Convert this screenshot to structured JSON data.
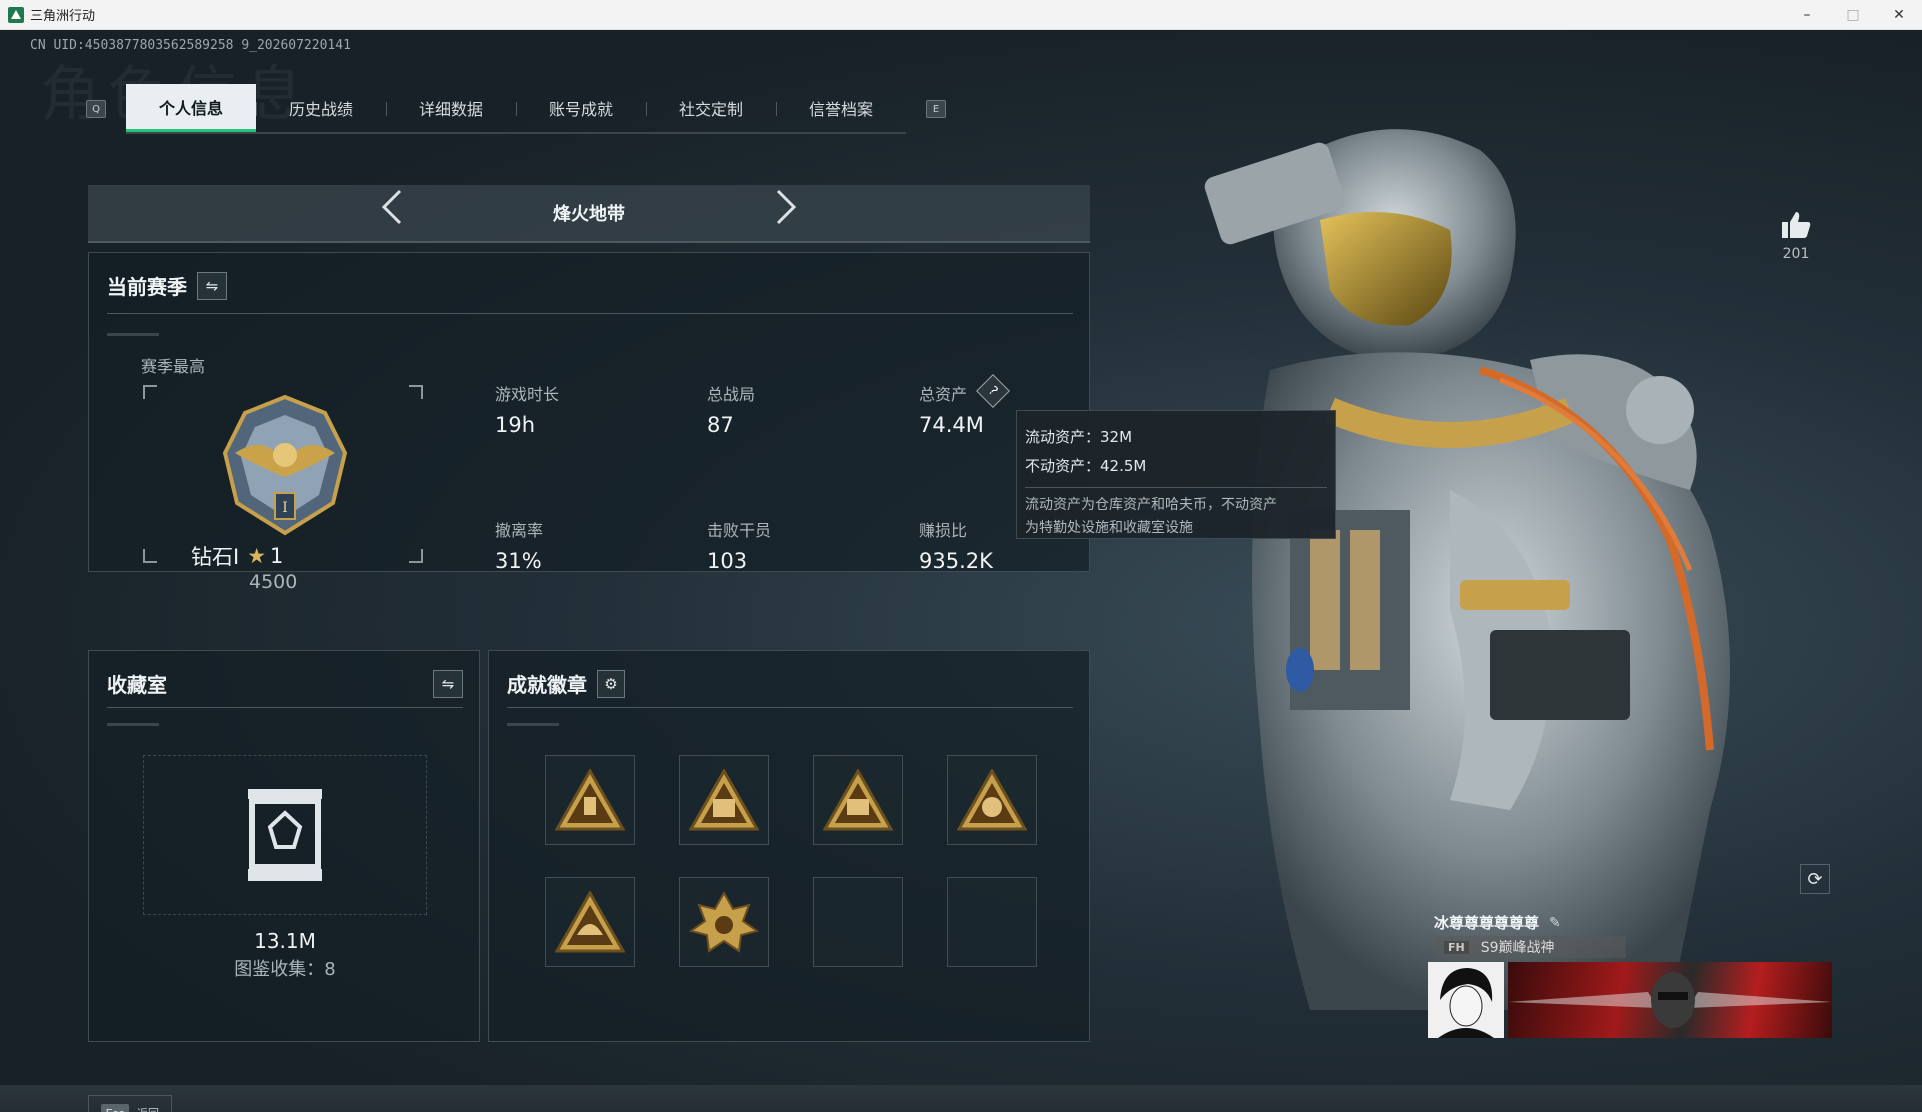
{
  "window": {
    "title": "三角洲行动",
    "min": "–",
    "max": "□",
    "close": "✕"
  },
  "uid": "CN UID:4503877803562589258 9_202607220141",
  "bg_watermark": "角色信息",
  "tabs": {
    "left_key": "Q",
    "right_key": "E",
    "items": [
      {
        "label": "个人信息",
        "active": true
      },
      {
        "label": "历史战绩"
      },
      {
        "label": "详细数据"
      },
      {
        "label": "账号成就"
      },
      {
        "label": "社交定制"
      },
      {
        "label": "信誉档案"
      }
    ]
  },
  "mode": {
    "title": "烽火地带",
    "prev_icon": "chevron-left",
    "next_icon": "chevron-right"
  },
  "season": {
    "title": "当前赛季",
    "peak_label": "赛季最高",
    "rank_name": "钻石I",
    "rank_star_count": "1",
    "rank_score": "4500",
    "stats": {
      "play_time_label": "游戏时长",
      "play_time": "19h",
      "total_matches_label": "总战局",
      "total_matches": "87",
      "total_assets_label": "总资产",
      "total_assets": "74.4M",
      "extract_rate_label": "撤离率",
      "extract_rate": "31%",
      "kills_label": "击败干员",
      "kills": "103",
      "profit_ratio_label": "赚损比",
      "profit_ratio": "935.2K"
    },
    "help_icon": "?"
  },
  "tooltip": {
    "liquid": "流动资产：32M",
    "fixed": "不动资产：42.5M",
    "desc_line1": "流动资产为仓库资产和哈夫币，不动资产",
    "desc_line2": "为特勤处设施和收藏室设施"
  },
  "collection": {
    "title": "收藏室",
    "value": "13.1M",
    "catalog": "图鉴收集：8"
  },
  "achievements": {
    "title": "成就徽章",
    "badges": [
      "warning-triangle-badge",
      "box-triangle-badge",
      "s9-triangle-badge",
      "trophy-triangle-badge",
      "helmet-triangle-badge",
      "spiky-badge",
      "",
      ""
    ]
  },
  "like": {
    "count": "201"
  },
  "profile": {
    "name": "冰尊尊尊尊尊尊",
    "tag": "FH",
    "title": "S9巅峰战神",
    "id": "4503877803562589258 9"
  },
  "footer": {
    "esc_key": "Esc",
    "back": "返回"
  },
  "colors": {
    "accent": "#23c37c",
    "panel": "#141f26",
    "gold": "#c7a04b"
  }
}
